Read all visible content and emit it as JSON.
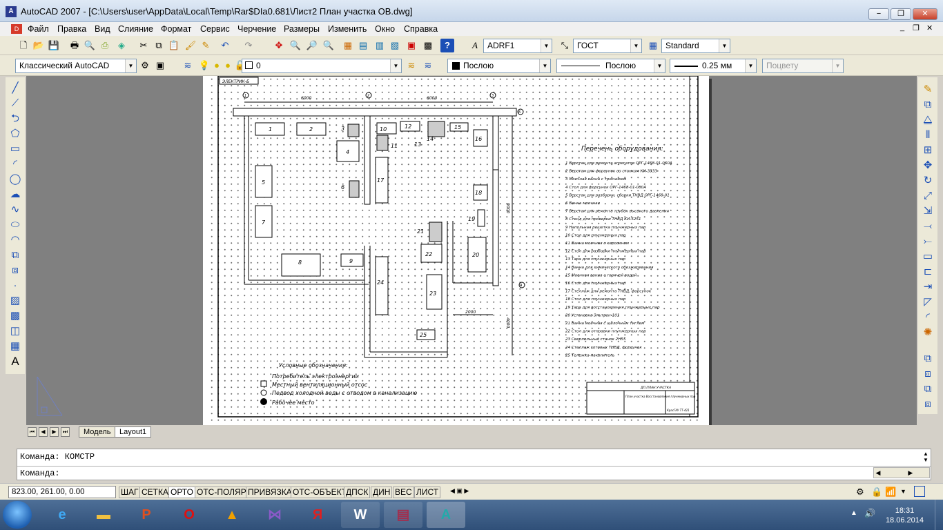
{
  "window": {
    "title": "AutoCAD 2007 - [C:\\Users\\user\\AppData\\Local\\Temp\\Rar$DIa0.681\\Лист2 План участка ОВ.dwg]",
    "controls": {
      "minimize": "−",
      "restore": "❐",
      "close": "✕"
    }
  },
  "menu": [
    "Файл",
    "Правка",
    "Вид",
    "Слияние",
    "Формат",
    "Сервис",
    "Черчение",
    "Размеры",
    "Изменить",
    "Окно",
    "Справка"
  ],
  "toolbar": {
    "text_style": "ADRF1",
    "dim_style": "ГОСТ",
    "table_style": "Standard",
    "workspace": "Классический AutoCAD",
    "layer": "0",
    "color": "Послою",
    "linetype": "Послою",
    "lineweight": "0.25 мм",
    "plot_style": "Поцвету"
  },
  "drawing": {
    "stamp": "ЭЛЕКТРИК-Б",
    "dim_6000_a": "6000",
    "dim_6000_b": "6000",
    "dim_9000": "9000",
    "dim_2000": "2000",
    "dim_4000": "4000",
    "axis_1": "1",
    "axis_2": "2",
    "axis_3": "3",
    "axis_b": "Б",
    "axis_a": "А",
    "equipment_numbers": [
      "1",
      "2",
      "3",
      "4",
      "5",
      "6",
      "7",
      "8",
      "9",
      "10",
      "11",
      "12",
      "13",
      "14",
      "15",
      "16",
      "17",
      "18",
      "19",
      "20",
      "21",
      "22",
      "23",
      "24",
      "25"
    ],
    "list_title": "Перечень оборудования:",
    "equipment_list": [
      "1 Верстак для ремонта агрегатов ОРГ-1468-01-060А",
      "2 Верстак для форсунок со станком КИ-3333",
      "3 Моечная ванна с тросником",
      "4 Стол для форсунок ОРГ-1468-01-080А",
      "5 Верстак для разборки, сборки ТНВД ОРГ-1468-01",
      "6 Ванна моечная",
      "7 Верстак для ремонта трубок высокого давления",
      "8 Стенд для проверки ТНВД КИ-5251",
      "9 Напольная решетка плунжерных пар",
      "10 Стол для плунжерных пар",
      "11 Ванна моечная с керосином",
      "12 Стол для разборки плунжерных пар",
      "13 Тара для плунжерных пар",
      "14 Ванна для химического обезжиривания",
      "15 Моечная ванна с горячей водой",
      "16 Стол для плунжерных пар",
      "17 Стеллаж для ремонта ТНВД, форсунок",
      "18 Стол для плунжерных пар",
      "19 Тара для восстановления плунжерных пар",
      "20 Установка Эльтрон-101",
      "21 Ванна моечная с щелочным тиглем",
      "22 Стол для отправки плунжерных пар",
      "23 Сверлильный станок 2Н55",
      "24 Стеллаж готовых ТНВД, форсунок",
      "25 Тележка-накопитель"
    ],
    "legend_title": "Условные обозначения:",
    "legend": [
      "Потребитель электроэнергии",
      "Местный вентиляционный отсос",
      "Подвод холодной воды с отводом в канализацию",
      "Рабочее место"
    ],
    "title_block_header": "ДП.ПЛАН.УЧАСТКА",
    "title_block_name": "План участка Восстановления плунжерных пар",
    "title_block_code": "КрасГАУ ТТ-421"
  },
  "tabs": [
    "Модель",
    "Layout1"
  ],
  "command": {
    "line1": "Команда:  КОМСТР",
    "line2": "Команда:"
  },
  "status": {
    "coords": "823.00, 261.00, 0.00",
    "buttons": [
      "ШАГ",
      "СЕТКА",
      "ОРТО",
      "ОТС-ПОЛЯР",
      "ПРИВЯЗКА",
      "ОТС-ОБЪЕКТ",
      "ДПСК",
      "ДИН",
      "ВЕС",
      "ЛИСТ"
    ]
  },
  "taskbar": {
    "apps": [
      "ie-icon",
      "explorer-icon",
      "powerpoint-icon",
      "opera-icon",
      "archicad-icon",
      "visual-studio-icon",
      "yandex-icon",
      "word-icon",
      "winrar-icon",
      "autocad-icon"
    ],
    "time": "18:31",
    "date": "18.06.2014"
  }
}
